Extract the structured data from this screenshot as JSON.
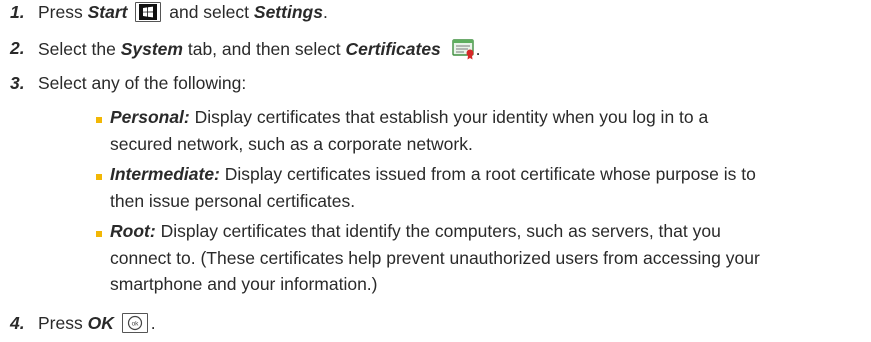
{
  "steps": [
    {
      "number": "1.",
      "parts": [
        "Press",
        "Start",
        "and select",
        "Settings",
        "."
      ]
    },
    {
      "number": "2.",
      "parts": [
        "Select the",
        "System",
        "tab, and then select",
        "Certificates",
        "."
      ]
    },
    {
      "number": "3.",
      "text": "Select any of the following:"
    },
    {
      "number": "4.",
      "parts": [
        "Press",
        "OK",
        "."
      ]
    }
  ],
  "options": [
    {
      "term": "Personal:",
      "lines": [
        "Display certificates that establish your identity when you log in to a",
        "secured network, such as a corporate network."
      ]
    },
    {
      "term": "Intermediate:",
      "lines": [
        "Display certificates issued from a root certificate whose purpose is to",
        "then issue personal certificates."
      ]
    },
    {
      "term": "Root:",
      "lines": [
        "Display certificates that identify the computers, such as servers, that you",
        "connect to. (These certificates help prevent unauthorized users from accessing your",
        "smartphone and your information.)"
      ]
    }
  ],
  "icons": {
    "start_key": "windows-start-key-icon",
    "certificates": "certificates-icon",
    "ok_key": "ok-key-icon"
  },
  "colors": {
    "text": "#2a2a2a",
    "bullet": "#f2b705"
  }
}
